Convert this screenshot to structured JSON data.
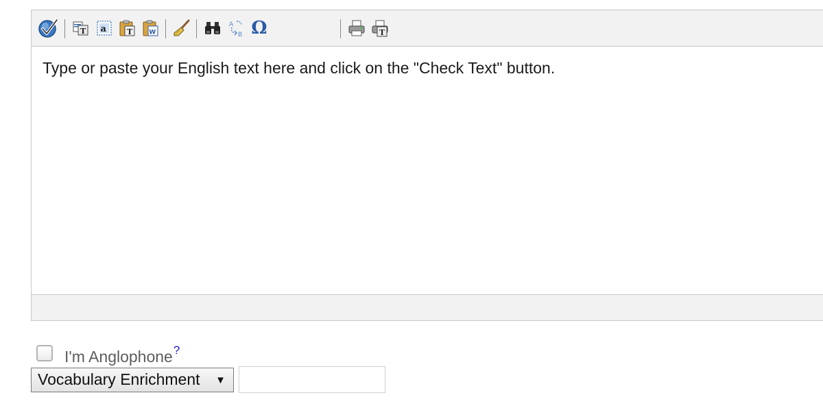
{
  "toolbar": {
    "icons": [
      "spellcheck-icon",
      "copy-text-icon",
      "select-all-icon",
      "paste-text-icon",
      "paste-word-icon",
      "clear-brush-icon",
      "find-binoculars-icon",
      "replace-icon",
      "special-character-icon",
      "print-icon",
      "print-text-icon"
    ],
    "omega_glyph": "Ω"
  },
  "editor": {
    "placeholder": "Type or paste your English text here and click on the \"Check Text\" button."
  },
  "options": {
    "anglophone_label": "I'm Anglophone",
    "anglophone_help": "?",
    "anglophone_checked": false,
    "mode_select_value": "Vocabulary Enrichment",
    "mode_select_arrow": "▼",
    "extra_input_value": ""
  },
  "colors": {
    "toolbar_bg": "#f2f2f2",
    "border": "#c8c8c8",
    "help_link": "#1a1acc",
    "label_text": "#5c5c5c"
  }
}
